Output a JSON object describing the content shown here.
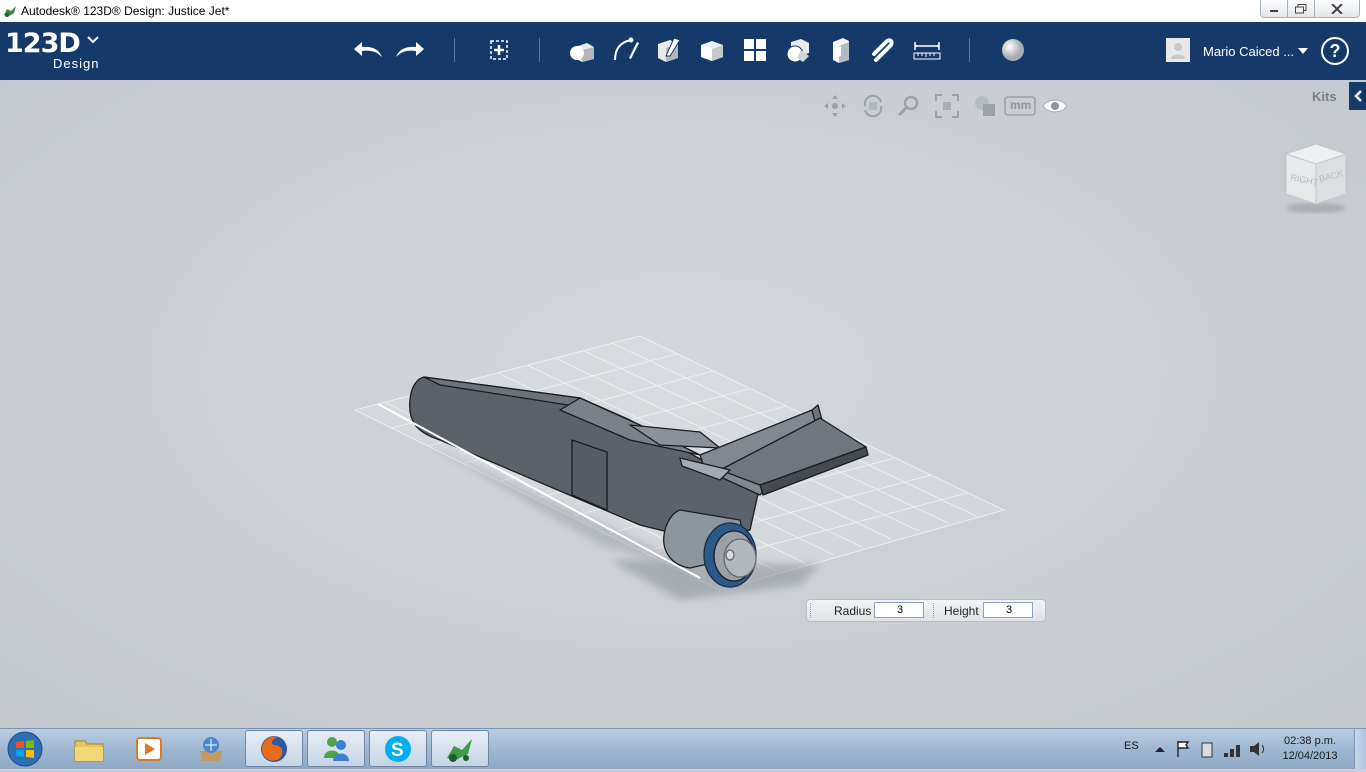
{
  "window": {
    "title": "Autodesk® 123D® Design: Justice Jet*"
  },
  "logo": {
    "main": "123D",
    "sub": "Design"
  },
  "toolbar": {
    "tools": [
      {
        "icon": "undo-icon"
      },
      {
        "icon": "redo-icon"
      },
      {
        "icon": "transform-icon"
      },
      {
        "icon": "primitives-icon"
      },
      {
        "icon": "sketch-icon"
      },
      {
        "icon": "construct-icon"
      },
      {
        "icon": "modify-icon"
      },
      {
        "icon": "pattern-icon"
      },
      {
        "icon": "group-icon"
      },
      {
        "icon": "combine-icon"
      },
      {
        "icon": "snap-icon"
      },
      {
        "icon": "measure-icon"
      },
      {
        "icon": "material-icon"
      }
    ],
    "user_name": "Mario Caiced ...",
    "help": "?"
  },
  "nav": {
    "units": "mm",
    "icons": [
      "pan-icon",
      "orbit-icon",
      "zoom-icon",
      "fit-icon",
      "material-view-icon",
      "units-icon",
      "visibility-icon"
    ]
  },
  "kits": {
    "label": "Kits"
  },
  "viewcube": {
    "faces": [
      "RIGHT",
      "BACK"
    ]
  },
  "input_panel": {
    "radius_label": "Radius",
    "radius_value": "3",
    "height_label": "Height",
    "height_value": "3"
  },
  "taskbar": {
    "apps": [
      "file-explorer-icon",
      "media-player-icon",
      "app-icon",
      "firefox-icon",
      "messenger-icon",
      "skype-icon",
      "123d-design-icon"
    ],
    "language": "ES",
    "time": "02:38 p.m.",
    "date": "12/04/2013"
  },
  "colors": {
    "toolbar_bg": "#153a6a",
    "viewport_bg": "#c9ced3",
    "model_gray": "#5b6269",
    "accent_blue": "#2a5a8c"
  }
}
